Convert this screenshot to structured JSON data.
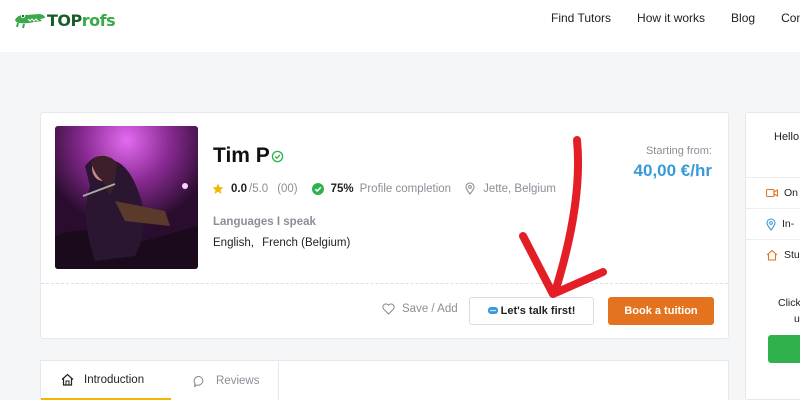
{
  "header": {
    "logo": {
      "part1": "TOP",
      "part2": "rofs"
    },
    "nav": [
      "Find Tutors",
      "How it works",
      "Blog",
      "Conta"
    ]
  },
  "profile": {
    "name": "Tim P",
    "rating": "0.0",
    "rating_max": "/5.0",
    "reviews_count": "(00)",
    "completion": "75%",
    "completion_label": "Profile completion",
    "location": "Jette, Belgium",
    "languages_title": "Languages I speak",
    "languages": [
      "English,",
      "French (Belgium)"
    ],
    "price_label": "Starting from:",
    "price": "40,00 €/hr",
    "save_label": "Save / Add",
    "talk_label": "Let's talk first!",
    "book_label": "Book a tuition"
  },
  "sidebar": {
    "hello": "Hello",
    "rows": [
      "On",
      "In-",
      "Stu"
    ],
    "click_line1": "Click",
    "click_line2": "u"
  },
  "tabs": [
    {
      "label": "Introduction"
    },
    {
      "label": "Reviews"
    }
  ],
  "colors": {
    "price": "#3a9ad9",
    "book_button": "#e4731f",
    "verified": "#2fb24c",
    "tab_underline": "#f2b705",
    "arrow": "#e41e26"
  }
}
